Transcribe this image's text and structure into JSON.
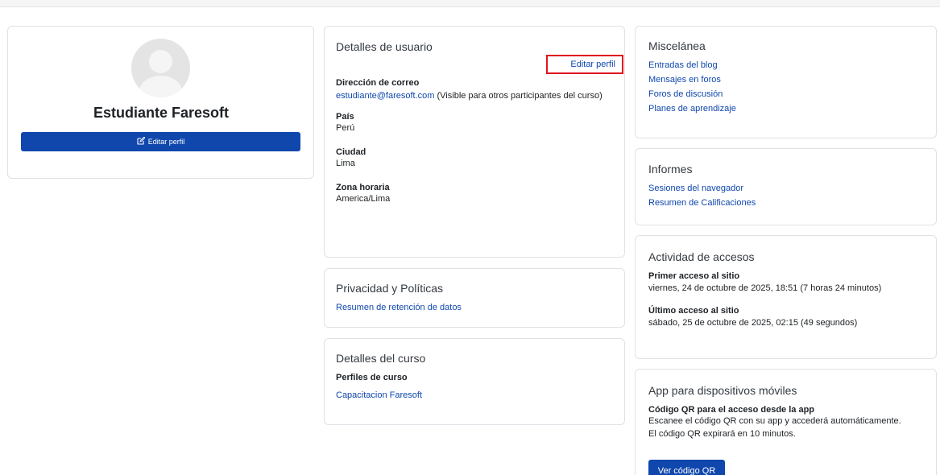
{
  "profile": {
    "name": "Estudiante Faresoft",
    "edit_button": "Editar perfil"
  },
  "user_details": {
    "title": "Detalles de usuario",
    "edit_link": "Editar perfil",
    "email_label": "Dirección de correo",
    "email_value": "estudiante@faresoft.com",
    "email_note": " (Visible para otros participantes del curso)",
    "country_label": "País",
    "country_value": "Perú",
    "city_label": "Ciudad",
    "city_value": "Lima",
    "timezone_label": "Zona horaria",
    "timezone_value": "America/Lima"
  },
  "privacy": {
    "title": "Privacidad y Políticas",
    "link": "Resumen de retención de datos"
  },
  "course_details": {
    "title": "Detalles del curso",
    "label": "Perfiles de curso",
    "link": "Capacitacion Faresoft"
  },
  "misc": {
    "title": "Miscelánea",
    "links": [
      "Entradas del blog",
      "Mensajes en foros",
      "Foros de discusión",
      "Planes de aprendizaje"
    ]
  },
  "reports": {
    "title": "Informes",
    "links": [
      "Sesiones del navegador",
      "Resumen de Calificaciones"
    ]
  },
  "access": {
    "title": "Actividad de accesos",
    "first_label": "Primer acceso al sitio",
    "first_value": "viernes, 24 de octubre de 2025, 18:51  (7 horas 24 minutos)",
    "last_label": "Último acceso al sitio",
    "last_value": "sábado, 25 de octubre de 2025, 02:15  (49 segundos)"
  },
  "mobile": {
    "title": "App para dispositivos móviles",
    "qr_label": "Código QR para el acceso desde la app",
    "qr_text_1": "Escanee el código QR con su app y accederá automáticamente.",
    "qr_text_2": "El código QR expirará en 10 minutos.",
    "qr_button": "Ver código QR"
  },
  "colors": {
    "brand": "#0f47ad",
    "highlight": "#e0141e"
  },
  "icons": {
    "edit": "edit-icon"
  }
}
